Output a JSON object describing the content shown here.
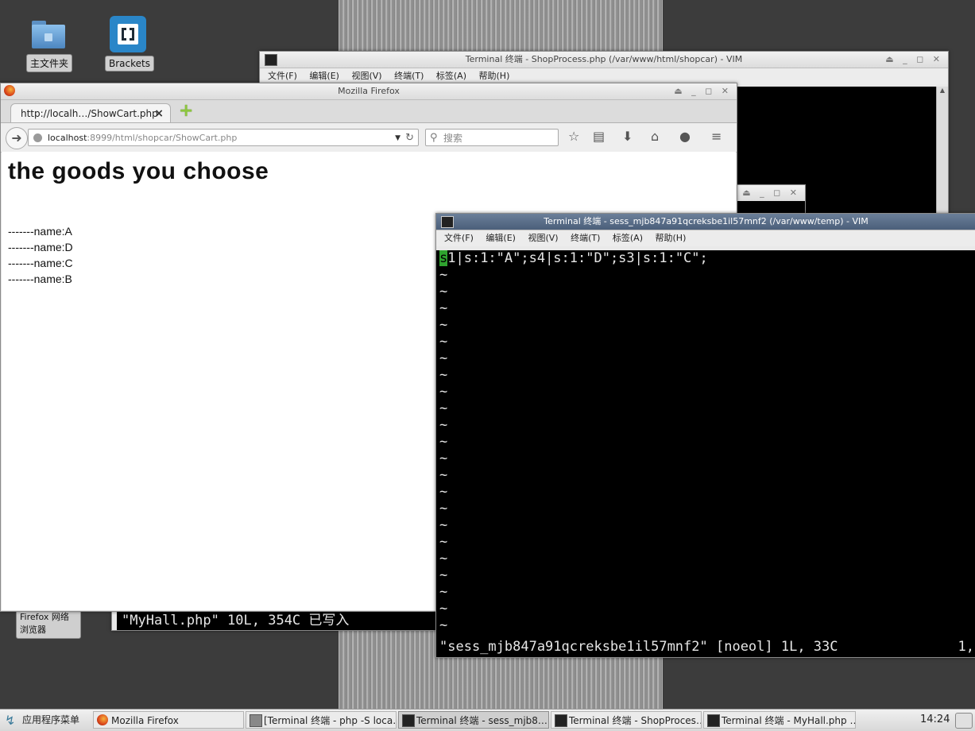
{
  "desktop": {
    "icons": [
      {
        "label": "主文件夹"
      },
      {
        "label": "Brackets"
      },
      {
        "label": "Firefox 网络浏览器"
      }
    ]
  },
  "terminal_shopprocess": {
    "title": "Terminal 终端 - ShopProcess.php (/var/www/html/shopcar) - VIM",
    "menu": [
      "文件(F)",
      "编辑(E)",
      "视图(V)",
      "终端(T)",
      "标签(A)",
      "帮助(H)"
    ]
  },
  "terminal_myhall": {
    "status_line": "\"MyHall.php\" 10L, 354C 已写入"
  },
  "firefox": {
    "title": "Mozilla Firefox",
    "tab_label": "http://localh…/ShowCart.php",
    "tab_close": "×",
    "new_tab": "+",
    "url_host": "localhost",
    "url_rest": ":8999/html/shopcar/ShowCart.php",
    "search_placeholder": "搜索",
    "page": {
      "heading": "the goods you choose",
      "items": [
        "-------name:A",
        "-------name:D",
        "-------name:C",
        "-------name:B"
      ]
    }
  },
  "terminal_session": {
    "title": "Terminal 终端 - sess_mjb847a91qcreksbe1il57mnf2 (/var/www/temp) - VIM",
    "menu": [
      "文件(F)",
      "编辑(E)",
      "视图(V)",
      "终端(T)",
      "标签(A)",
      "帮助(H)"
    ],
    "cursor_char": "s",
    "line1_rest": "1|s:1:\"A\";s4|s:1:\"D\";s3|s:1:\"C\";",
    "tilde": "~",
    "status_line": "\"sess_mjb847a91qcreksbe1il57mnf2\" [noeol] 1L, 33C",
    "status_pos": "1,"
  },
  "taskbar": {
    "start_label": "应用程序菜单",
    "items": [
      {
        "label": "Mozilla Firefox"
      },
      {
        "label": "[Terminal 终端 - php -S loca…"
      },
      {
        "label": "Terminal 终端 - sess_mjb8…"
      },
      {
        "label": "Terminal 终端 - ShopProces…"
      },
      {
        "label": "Terminal 终端 - MyHall.php …"
      }
    ],
    "clock": "14:24"
  },
  "colors": {
    "desktop_bg": "#3c3c3c",
    "cursor_green": "#2fa32f",
    "active_title": "#4b5f7a"
  }
}
